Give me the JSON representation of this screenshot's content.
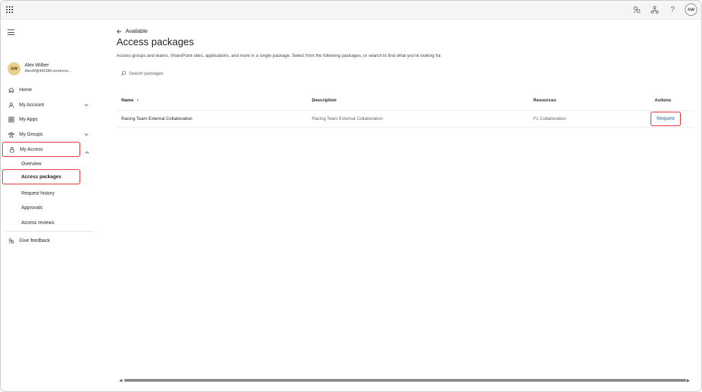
{
  "topbar": {
    "avatar_initials": "AW",
    "icons": [
      "app-launcher-icon",
      "feedback-icon",
      "organization-icon",
      "help-icon"
    ],
    "help_glyph": "?"
  },
  "user": {
    "initials": "AW",
    "name": "Alex Wilber",
    "email": "AlexW@48238h.onmicros..."
  },
  "sidebar": {
    "items": [
      {
        "label": "Home",
        "icon": "home-icon"
      },
      {
        "label": "My Account",
        "icon": "person-icon"
      },
      {
        "label": "My Apps",
        "icon": "apps-icon"
      },
      {
        "label": "My Groups",
        "icon": "groups-icon"
      },
      {
        "label": "My Access",
        "icon": "lock-icon"
      }
    ],
    "sub_items": [
      {
        "label": "Overview"
      },
      {
        "label": "Access packages"
      },
      {
        "label": "Request history"
      },
      {
        "label": "Approvals"
      },
      {
        "label": "Access reviews"
      }
    ],
    "feedback_label": "Give feedback"
  },
  "main": {
    "back_label": "Available",
    "title": "Access packages",
    "description": "Access groups and teams, SharePoint sites, applications, and more in a single package. Select from the following packages, or search to find what you're looking for.",
    "search_placeholder": "Search packages"
  },
  "table": {
    "columns": [
      "Name",
      "Description",
      "Resources",
      "Actions"
    ],
    "sort_glyph": "↑",
    "rows": [
      {
        "name": "Racing Team External Collaboration",
        "description": "Racing Team External Collaboration",
        "resources": "F1 Collaboration",
        "action": "Request"
      }
    ]
  },
  "colors": {
    "accent": "#0f6cbd",
    "highlight": "#e02b2b",
    "avatar": "#e8cf8e"
  }
}
